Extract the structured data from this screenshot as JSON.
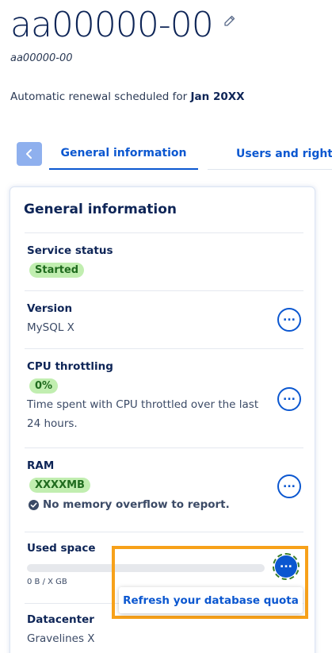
{
  "header": {
    "title": "aa00000-00",
    "subtitle": "aa00000-00",
    "renewal_prefix": "Automatic renewal scheduled for ",
    "renewal_date": "Jan 20XX"
  },
  "tabs": [
    {
      "label": "General information",
      "active": true
    },
    {
      "label": "Users and rights",
      "active": false
    }
  ],
  "card": {
    "title": "General information",
    "service_status": {
      "label": "Service status",
      "badge": "Started"
    },
    "version": {
      "label": "Version",
      "value": "MySQL X"
    },
    "cpu": {
      "label": "CPU throttling",
      "badge": "0%",
      "description": "Time spent with CPU throttled over the last 24 hours."
    },
    "ram": {
      "label": "RAM",
      "badge": "XXXXMB",
      "note": "No memory overflow to report."
    },
    "used_space": {
      "label": "Used space",
      "progress_text": "0 B / X GB",
      "progress_fraction": 0
    },
    "datacenter": {
      "label": "Datacenter",
      "value": "Gravelines X"
    }
  },
  "popup": {
    "label": "Refresh your database quota"
  },
  "icons": {
    "edit": "pencil-icon",
    "back": "chevron-left-icon",
    "more": "ellipsis-icon",
    "check": "check-circle-icon"
  },
  "colors": {
    "primary": "#0b57d0",
    "title": "#0e2557",
    "badge_bg": "#c1eeb0",
    "badge_text": "#1f6b1e",
    "highlight": "#f7a11a"
  }
}
